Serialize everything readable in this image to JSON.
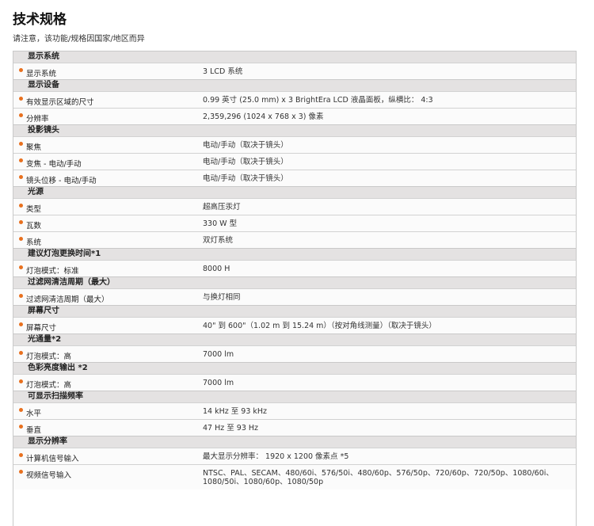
{
  "page": {
    "title": "技术规格",
    "note": "请注意，该功能/规格因国家/地区而异"
  },
  "sections": [
    {
      "title": "显示系统",
      "rows": [
        {
          "label": "显示系统",
          "value": "3 LCD 系统"
        }
      ]
    },
    {
      "title": "显示设备",
      "rows": [
        {
          "label": "有效显示区域的尺寸",
          "value": "0.99 英寸 (25.0 mm) x 3 BrightEra LCD 液晶面板，纵横比： 4:3"
        },
        {
          "label": "分辨率",
          "value": "2,359,296 (1024 x 768 x 3) 像素"
        }
      ]
    },
    {
      "title": "投影镜头",
      "rows": [
        {
          "label": "聚焦",
          "value": "电动/手动（取决于镜头）"
        },
        {
          "label": "变焦 - 电动/手动",
          "value": "电动/手动（取决于镜头）"
        },
        {
          "label": "镜头位移 - 电动/手动",
          "value": "电动/手动（取决于镜头）"
        }
      ]
    },
    {
      "title": "光源",
      "rows": [
        {
          "label": "类型",
          "value": "超高压汞灯"
        },
        {
          "label": "瓦数",
          "value": "330 W 型"
        },
        {
          "label": "系统",
          "value": "双灯系统"
        }
      ]
    },
    {
      "title": "建议灯泡更换时间*1",
      "rows": [
        {
          "label": "灯泡模式：标准",
          "value": "8000 H"
        }
      ]
    },
    {
      "title": "过滤网清洁周期（最大）",
      "rows": [
        {
          "label": "过滤网清洁周期（最大）",
          "value": "与换灯相同"
        }
      ]
    },
    {
      "title": "屏幕尺寸",
      "rows": [
        {
          "label": "屏幕尺寸",
          "value": "40\" 到 600\"（1.02 m 到 15.24 m）（按对角线测量）（取决于镜头）"
        }
      ]
    },
    {
      "title": "光通量*2",
      "rows": [
        {
          "label": "灯泡模式：高",
          "value": "7000 lm"
        }
      ]
    },
    {
      "title": "色彩亮度输出 *2",
      "rows": [
        {
          "label": "灯泡模式：高",
          "value": "7000 lm"
        }
      ]
    },
    {
      "title": "可显示扫描频率",
      "rows": [
        {
          "label": "水平",
          "value": "14 kHz 至 93 kHz"
        },
        {
          "label": "垂直",
          "value": "47 Hz 至 93 Hz"
        }
      ]
    },
    {
      "title": "显示分辨率",
      "rows": [
        {
          "label": "计算机信号输入",
          "value": "最大显示分辨率： 1920 x 1200 像素点 *5"
        },
        {
          "label": "视频信号输入",
          "value": "NTSC、PAL、SECAM、480/60i、576/50i、480/60p、576/50p、720/60p、720/50p、1080/60i、1080/50i、1080/60p、1080/50p"
        }
      ]
    }
  ],
  "colors": {
    "bullet": "#e8701e",
    "section_bg": "#e4e2e2",
    "border": "#c9c9c9"
  }
}
